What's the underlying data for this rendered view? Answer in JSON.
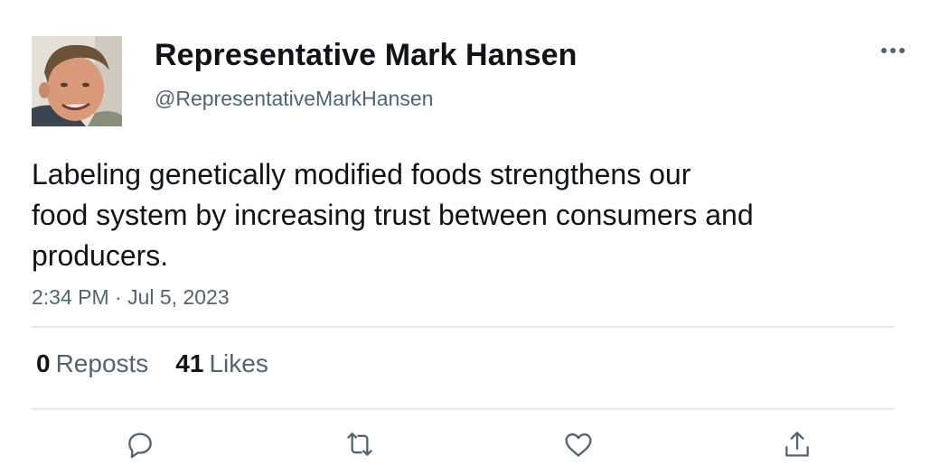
{
  "author": {
    "display_name": "Representative Mark Hansen",
    "handle": "@RepresentativeMarkHansen",
    "avatar_icon": "profile-photo"
  },
  "tweet": {
    "text_lines": [
      "Labeling genetically modified foods strengthens our",
      "food system by increasing trust between consumers and",
      "producers."
    ],
    "timestamp": "2:34 PM · Jul 5, 2023"
  },
  "stats": {
    "reposts": {
      "count": "0",
      "label": "Reposts"
    },
    "likes": {
      "count": "41",
      "label": "Likes"
    }
  },
  "actions": [
    {
      "name": "reply",
      "icon": "reply-icon"
    },
    {
      "name": "repost",
      "icon": "repost-icon"
    },
    {
      "name": "like",
      "icon": "heart-icon"
    },
    {
      "name": "share",
      "icon": "share-icon"
    }
  ],
  "colors": {
    "primary_text": "#0f1419",
    "secondary_text": "#536471",
    "divider": "#e6e8ea",
    "icon": "#536471"
  }
}
